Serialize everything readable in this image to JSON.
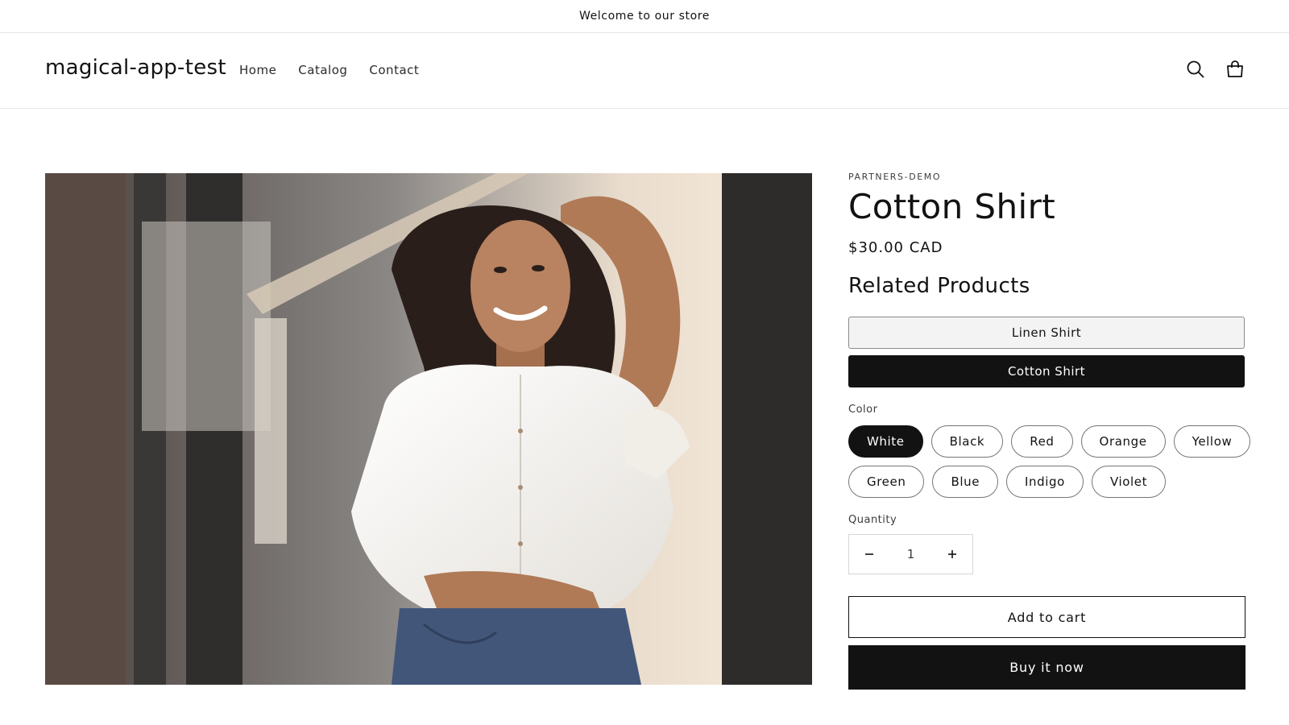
{
  "announcement": {
    "text": "Welcome to our store"
  },
  "header": {
    "logo": "magical-app-test",
    "nav": [
      "Home",
      "Catalog",
      "Contact"
    ],
    "icons": {
      "search": "search-icon",
      "cart": "cart-icon"
    }
  },
  "media": {
    "icon": "product-photo",
    "colors": {
      "background": "#6b6460",
      "shirt": "#f6f3ee",
      "jeans": "#42567a",
      "skin": "#b07a56",
      "hair": "#2a1e1a"
    }
  },
  "product": {
    "vendor": "PARTNERS-DEMO",
    "title": "Cotton Shirt",
    "price": "$30.00 CAD",
    "related_heading": "Related Products",
    "related": [
      {
        "label": "Linen Shirt",
        "selected": false
      },
      {
        "label": "Cotton Shirt",
        "selected": true
      }
    ],
    "color_label": "Color",
    "colors": [
      "White",
      "Black",
      "Red",
      "Orange",
      "Yellow",
      "Green",
      "Blue",
      "Indigo",
      "Violet"
    ],
    "selected_color": "White",
    "quantity_label": "Quantity",
    "quantity": "1",
    "add_to_cart": "Add to cart",
    "buy_now": "Buy it now"
  },
  "theme": {
    "accent": "#121212",
    "border": "#757575",
    "light_button": "#f3f3f3"
  }
}
